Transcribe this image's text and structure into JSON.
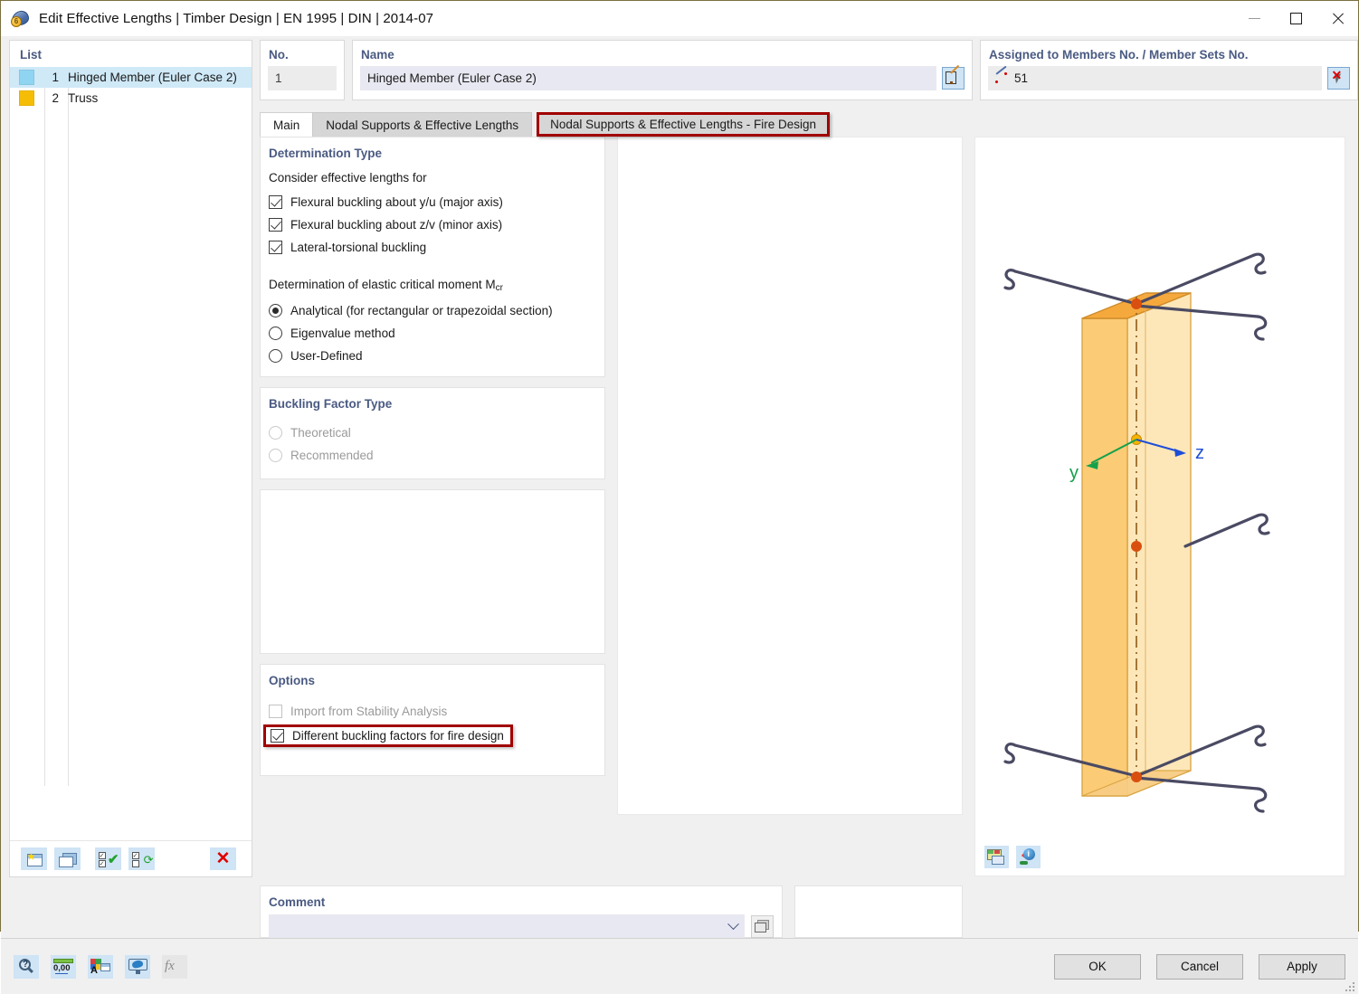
{
  "window": {
    "title": "Edit Effective Lengths | Timber Design | EN 1995 | DIN | 2014-07",
    "icon": "app-icon",
    "minimize": "–",
    "maximize": "□",
    "close": "×"
  },
  "list_panel": {
    "title": "List",
    "items": [
      {
        "num": "1",
        "label": "Hinged Member (Euler Case 2)",
        "color": "#8fd4f0",
        "selected": true
      },
      {
        "num": "2",
        "label": "Truss",
        "color": "#f6bd07",
        "selected": false
      }
    ],
    "toolbar": [
      {
        "name": "new-item-button",
        "icon": "new-window-icon"
      },
      {
        "name": "copy-item-button",
        "icon": "copy-window-icon"
      },
      {
        "name": "select-all-button",
        "icon": "checklist-check-icon"
      },
      {
        "name": "invert-selection-button",
        "icon": "checklist-swap-icon"
      },
      {
        "name": "delete-item-button",
        "icon": "red-x-icon",
        "glyph": "✕"
      }
    ]
  },
  "fields": {
    "no_label": "No.",
    "no_value": "1",
    "name_label": "Name",
    "name_value": "Hinged Member (Euler Case 2)",
    "name_edit_icon": "edit-pencil-icon",
    "assigned_label": "Assigned to Members No. / Member Sets No.",
    "assigned_value": "51",
    "assigned_member_icon": "member-icon",
    "assigned_pick_icon": "pick-cursor-icon"
  },
  "tabs": [
    {
      "label": "Main",
      "active": true,
      "highlighted": false
    },
    {
      "label": "Nodal Supports & Effective Lengths",
      "active": false,
      "highlighted": false
    },
    {
      "label": "Nodal Supports & Effective Lengths - Fire Design",
      "active": false,
      "highlighted": true
    }
  ],
  "determination_type": {
    "title": "Determination Type",
    "consider_label": "Consider effective lengths for",
    "checkboxes": [
      {
        "label": "Flexural buckling about y/u (major axis)",
        "checked": true,
        "disabled": false
      },
      {
        "label": "Flexural buckling about z/v (minor axis)",
        "checked": true,
        "disabled": false
      },
      {
        "label": "Lateral-torsional buckling",
        "checked": true,
        "disabled": false
      }
    ],
    "mcr_label_main": "Determination of elastic critical moment M",
    "mcr_label_sub": "cr",
    "radios": [
      {
        "label": "Analytical (for rectangular or trapezoidal section)",
        "selected": true,
        "disabled": false
      },
      {
        "label": "Eigenvalue method",
        "selected": false,
        "disabled": false
      },
      {
        "label": "User-Defined",
        "selected": false,
        "disabled": false
      }
    ]
  },
  "buckling_factor_type": {
    "title": "Buckling Factor Type",
    "radios": [
      {
        "label": "Theoretical",
        "selected": false,
        "disabled": true
      },
      {
        "label": "Recommended",
        "selected": false,
        "disabled": true
      }
    ]
  },
  "options": {
    "title": "Options",
    "checkboxes": [
      {
        "label": "Import from Stability Analysis",
        "checked": false,
        "disabled": true,
        "highlighted": false
      },
      {
        "label": "Different buckling factors for fire design",
        "checked": true,
        "disabled": false,
        "highlighted": true
      }
    ]
  },
  "comment": {
    "title": "Comment",
    "value": "",
    "placeholder": "",
    "dropdown_icon": "chevron-down-icon",
    "button_icon": "comment-template-icon"
  },
  "view3d": {
    "axis_y_label": "y",
    "axis_z_label": "z",
    "axis_y_color": "#15a04a",
    "axis_z_color": "#1d4ed8",
    "member_fill": "#fbd58b",
    "member_fill_light": "#fde6b6",
    "member_top": "#f5a93c",
    "member_stroke": "#c98b2c",
    "node_color": "#d94f10",
    "origin_color": "#f5b400",
    "support_color": "#4a4a63",
    "toolbar": [
      {
        "name": "render-settings-button",
        "icon": "render-table-icon"
      },
      {
        "name": "view-info-button",
        "icon": "info-pin-icon"
      }
    ]
  },
  "bottom_toolbar": [
    {
      "name": "help-button",
      "icon": "magnifier-help-icon",
      "disabled": false
    },
    {
      "name": "units-button",
      "icon": "decimal-units-icon",
      "label": "0,00",
      "disabled": false
    },
    {
      "name": "display-properties-button",
      "icon": "colors-a-icon",
      "disabled": false
    },
    {
      "name": "view-mode-button",
      "icon": "monitor-icon",
      "disabled": false
    },
    {
      "name": "formula-button",
      "icon": "fx-icon",
      "label": "fx",
      "disabled": true
    }
  ],
  "dialog_buttons": [
    {
      "label": "OK",
      "name": "ok-button"
    },
    {
      "label": "Cancel",
      "name": "cancel-button"
    },
    {
      "label": "Apply",
      "name": "apply-button"
    }
  ],
  "colors": {
    "accent_heading": "#4a5a82",
    "highlight_red": "#a00000",
    "selection_blue": "#cfe9f7",
    "field_gray": "#ececec",
    "field_lavender": "#e8e8f2"
  }
}
